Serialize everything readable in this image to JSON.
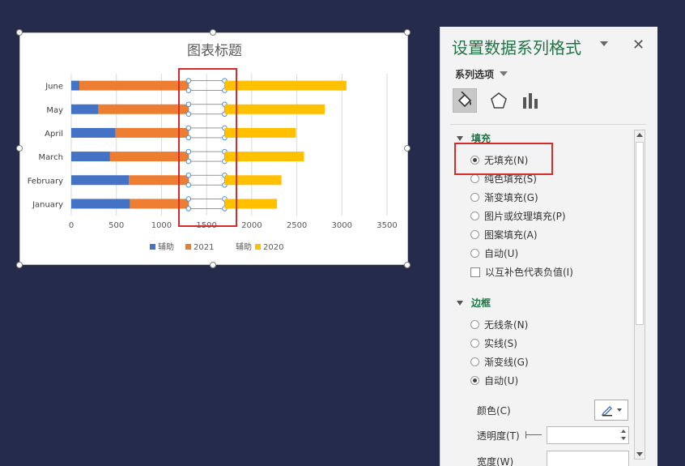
{
  "chart_data": {
    "type": "bar",
    "orientation": "horizontal",
    "stacked": true,
    "title": "图表标题",
    "categories": [
      "January",
      "February",
      "March",
      "April",
      "May",
      "June"
    ],
    "series": [
      {
        "name": "辅助",
        "color": "#4472c4",
        "values": [
          650,
          640,
          430,
          490,
          300,
          90
        ]
      },
      {
        "name": "2021",
        "color": "#ed7d31",
        "values": [
          650,
          660,
          870,
          810,
          1000,
          1210
        ]
      },
      {
        "name": "辅助",
        "color": "none",
        "values": [
          400,
          400,
          400,
          400,
          400,
          400
        ]
      },
      {
        "name": "2020",
        "color": "#ffc000",
        "values": [
          580,
          630,
          880,
          790,
          1110,
          1350
        ]
      }
    ],
    "xlim": [
      0,
      3500
    ],
    "xticks": [
      "0",
      "500",
      "1000",
      "1500",
      "2000",
      "2500",
      "3000",
      "3500"
    ],
    "grid": true,
    "legend": "bottom"
  },
  "pane": {
    "title": "设置数据系列格式",
    "close": "✕",
    "series_options": "系列选项",
    "tabs": [
      "fill-line",
      "effects",
      "series-options"
    ],
    "fill": {
      "header": "填充",
      "options": [
        "无填充(N)",
        "纯色填充(S)",
        "渐变填充(G)",
        "图片或纹理填充(P)",
        "图案填充(A)",
        "自动(U)"
      ],
      "selected": "无填充(N)",
      "invert": "以互补色代表负值(I)"
    },
    "border": {
      "header": "边框",
      "options": [
        "无线条(N)",
        "实线(S)",
        "渐变线(G)",
        "自动(U)"
      ],
      "selected": "自动(U)",
      "color_label": "颜色(C)",
      "transparency_label": "透明度(T)",
      "width_label": "宽度(W)"
    }
  }
}
